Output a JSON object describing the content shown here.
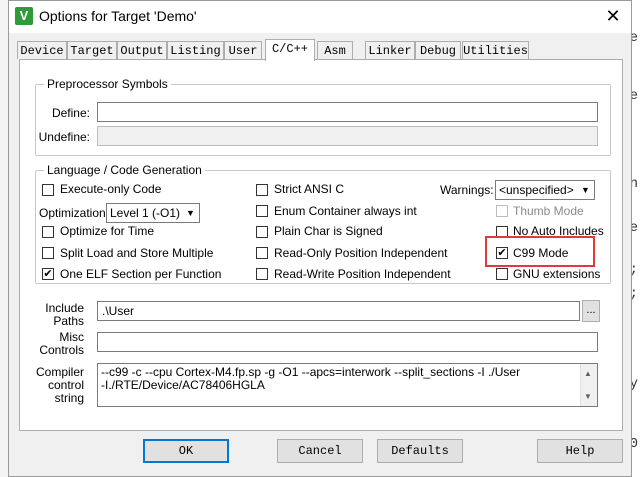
{
  "window": {
    "title": "Options for Target 'Demo'",
    "app_icon": "V",
    "close_glyph": "✕"
  },
  "tabs": [
    {
      "label": "Device"
    },
    {
      "label": "Target"
    },
    {
      "label": "Output"
    },
    {
      "label": "Listing"
    },
    {
      "label": "User"
    },
    {
      "label": "C/C++",
      "active": true
    },
    {
      "label": "Asm"
    },
    {
      "label": "Linker"
    },
    {
      "label": "Debug"
    },
    {
      "label": "Utilities"
    }
  ],
  "preprocessor": {
    "group_title": "Preprocessor Symbols",
    "define_label": "Define:",
    "define_value": "",
    "undefine_label": "Undefine:",
    "undefine_value": ""
  },
  "language": {
    "group_title": "Language / Code Generation",
    "execute_only": {
      "label": "Execute-only Code",
      "checked": false
    },
    "optimization_label": "Optimization:",
    "optimization_value": "Level 1 (-O1)",
    "optimize_time": {
      "label": "Optimize for Time",
      "checked": false
    },
    "split_ls": {
      "label": "Split Load and Store Multiple",
      "checked": false
    },
    "one_elf": {
      "label": "One ELF Section per Function",
      "checked": true,
      "mark": "✔"
    },
    "strict_ansi": {
      "label": "Strict ANSI C",
      "checked": false
    },
    "enum_container": {
      "label": "Enum Container always int",
      "checked": false
    },
    "plain_char": {
      "label": "Plain Char is Signed",
      "checked": false
    },
    "ropi": {
      "label": "Read-Only Position Independent",
      "checked": false
    },
    "rwpi": {
      "label": "Read-Write Position Independent",
      "checked": false
    },
    "warnings_label": "Warnings:",
    "warnings_value": "<unspecified>",
    "thumb_mode": {
      "label": "Thumb Mode",
      "checked": false,
      "disabled": true
    },
    "no_auto_includes": {
      "label": "No Auto Includes",
      "checked": false
    },
    "c99_mode": {
      "label": "C99 Mode",
      "checked": true,
      "mark": "✔"
    },
    "gnu_ext": {
      "label": "GNU extensions",
      "checked": false
    }
  },
  "include_paths": {
    "label_line1": "Include",
    "label_line2": "Paths",
    "value": ".\\User",
    "browse": "..."
  },
  "misc_controls": {
    "label_line1": "Misc",
    "label_line2": "Controls",
    "value": ""
  },
  "compiler_string": {
    "label_line1": "Compiler",
    "label_line2": "control",
    "label_line3": "string",
    "line1": "--c99 -c --cpu Cortex-M4.fp.sp -g -O1 --apcs=interwork --split_sections -I ./User",
    "line2": "-I./RTE/Device/AC78406HGLA"
  },
  "buttons": {
    "ok": "OK",
    "cancel": "Cancel",
    "defaults": "Defaults",
    "help": "Help"
  },
  "colors": {
    "highlight": "#e03a3a",
    "focus": "#0078d7"
  }
}
